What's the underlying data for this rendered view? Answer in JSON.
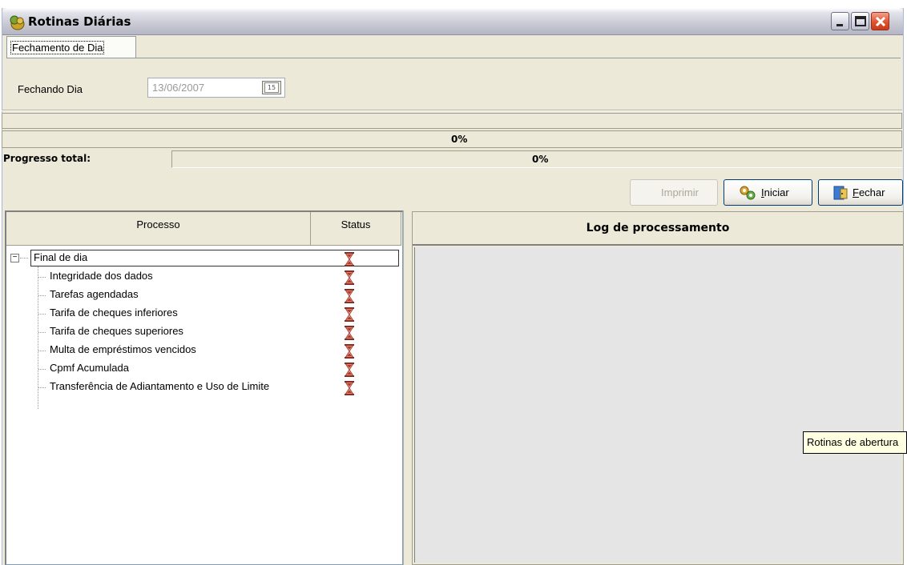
{
  "window": {
    "title": "Rotinas Diárias",
    "icon": "money-bag-icon"
  },
  "tabs": [
    {
      "label": "Fechamento de Dia"
    }
  ],
  "date_field": {
    "label": "Fechando Dia",
    "value": "13/06/2007",
    "calendar_icon": "calendar-icon",
    "calendar_text": "15"
  },
  "progress": {
    "current_text": "0%",
    "current_fraction": 0,
    "total_label": "Progresso total:",
    "total_text": "0%",
    "total_fraction": 0
  },
  "buttons": {
    "print": "Imprimir",
    "start": "Iniciar",
    "start_icon": "gears-icon",
    "close": "Fechar",
    "close_icon": "exit-door-icon"
  },
  "tree": {
    "col_process": "Processo",
    "col_status": "Status",
    "root": {
      "label": "Final de dia",
      "status_icon": "hourglass-icon"
    },
    "children": [
      {
        "label": "Integridade dos dados",
        "status_icon": "hourglass-icon"
      },
      {
        "label": "Tarefas agendadas",
        "status_icon": "hourglass-icon"
      },
      {
        "label": "Tarifa de cheques inferiores",
        "status_icon": "hourglass-icon"
      },
      {
        "label": "Tarifa de cheques superiores",
        "status_icon": "hourglass-icon"
      },
      {
        "label": "Multa de empréstimos vencidos",
        "status_icon": "hourglass-icon"
      },
      {
        "label": "Cpmf Acumulada",
        "status_icon": "hourglass-icon"
      },
      {
        "label": "Transferência de Adiantamento e Uso de Limite",
        "status_icon": "hourglass-icon"
      }
    ]
  },
  "log": {
    "title": "Log de processamento"
  },
  "tooltip": {
    "text": "Rotinas de abertura"
  },
  "colors": {
    "window_bg": "#ece9d8",
    "close_button": "#e0532f",
    "hourglass": "#b03a2e"
  }
}
